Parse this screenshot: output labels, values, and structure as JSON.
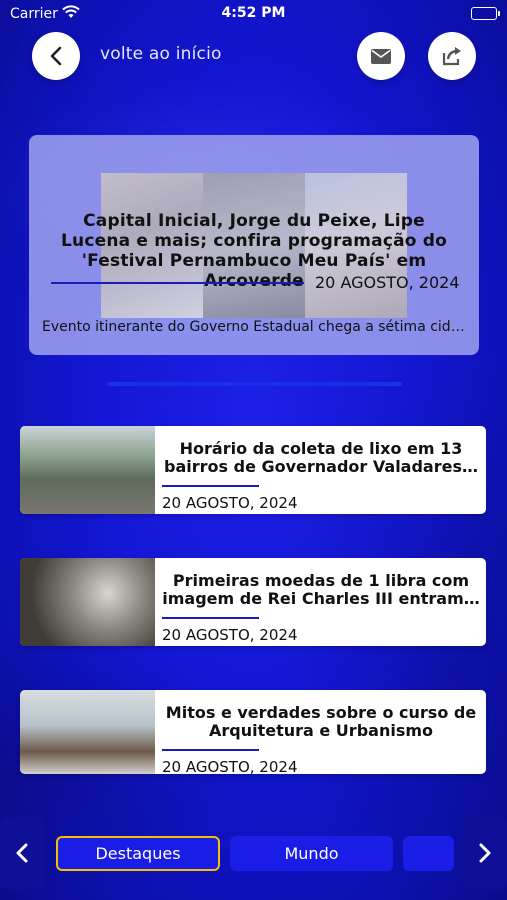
{
  "status_bar": {
    "carrier": "Carrier",
    "time": "4:52 PM"
  },
  "header": {
    "title": "volte ao início"
  },
  "featured": {
    "title": "Capital Inicial, Jorge du Peixe, Lipe Lucena e mais; confira programação do 'Festival Pernambuco Meu País' em Arcoverde",
    "date": "20 AGOSTO, 2024",
    "description": "Evento itinerante do Governo Estadual chega a sétima cid…"
  },
  "news": [
    {
      "title": "Horário da coleta de lixo em 13 bairros de Governador Valadares…",
      "date": "20 AGOSTO, 2024"
    },
    {
      "title": "Primeiras moedas de 1 libra com imagem de Rei Charles III entram…",
      "date": "20 AGOSTO, 2024"
    },
    {
      "title": "Mitos e verdades sobre o curso de Arquitetura e Urbanismo",
      "date": "20 AGOSTO, 2024"
    }
  ],
  "tabs": [
    {
      "label": "Destaques",
      "active": true
    },
    {
      "label": "Mundo",
      "active": false
    },
    {
      "label": "",
      "active": false
    }
  ],
  "colors": {
    "background": "#1316d3",
    "accent_line": "#1a1bb8",
    "active_tab_border": "#f2c200"
  }
}
